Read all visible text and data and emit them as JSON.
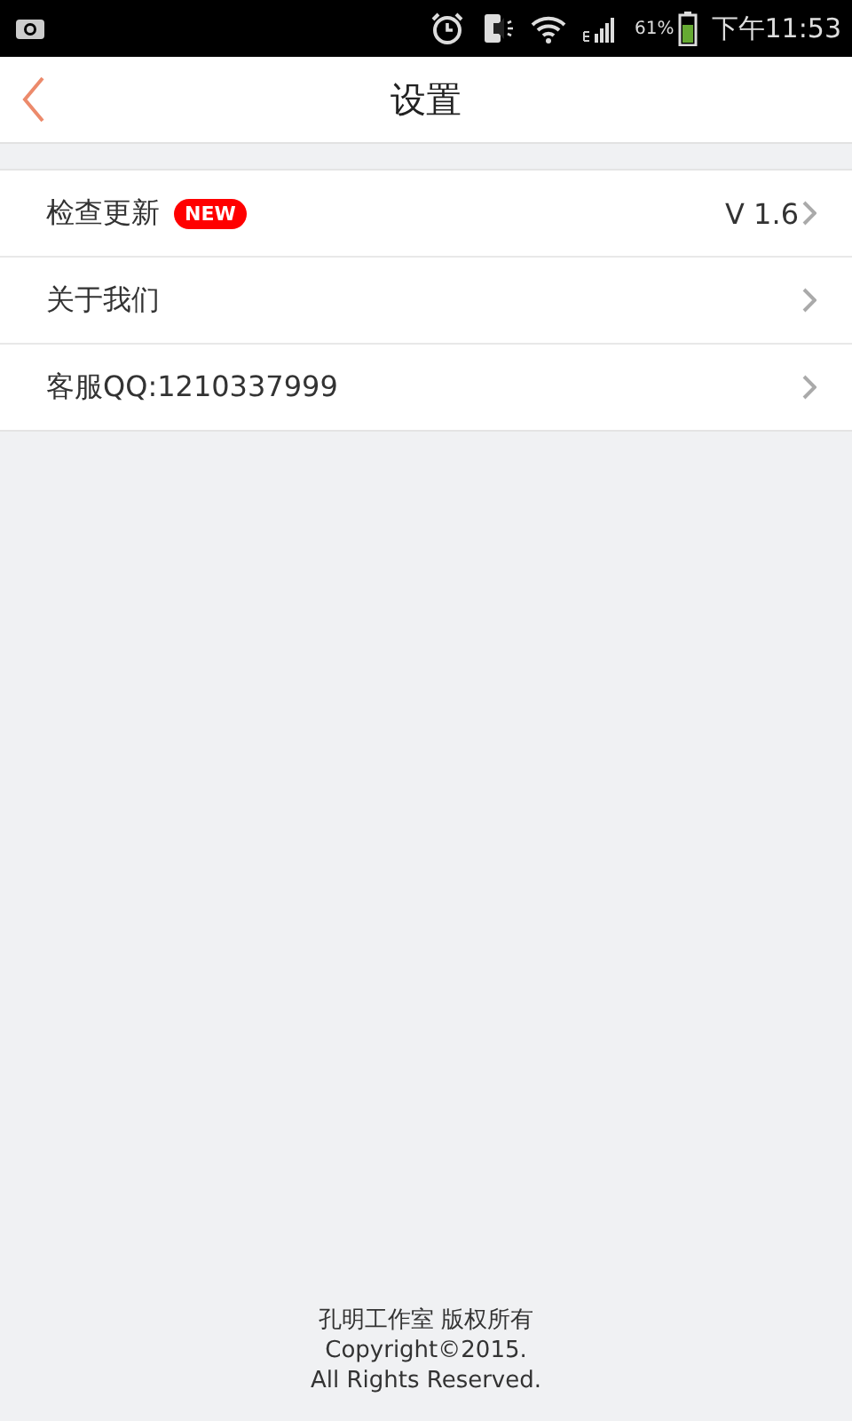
{
  "status_bar": {
    "battery": "61%",
    "time": "下午11:53"
  },
  "header": {
    "title": "设置"
  },
  "settings": [
    {
      "label": "检查更新",
      "badge": "NEW",
      "value": "V 1.6"
    },
    {
      "label": "关于我们"
    },
    {
      "label": "客服QQ:1210337999"
    }
  ],
  "footer": [
    "孔明工作室 版权所有",
    "Copyright©2015.",
    "All Rights Reserved."
  ]
}
